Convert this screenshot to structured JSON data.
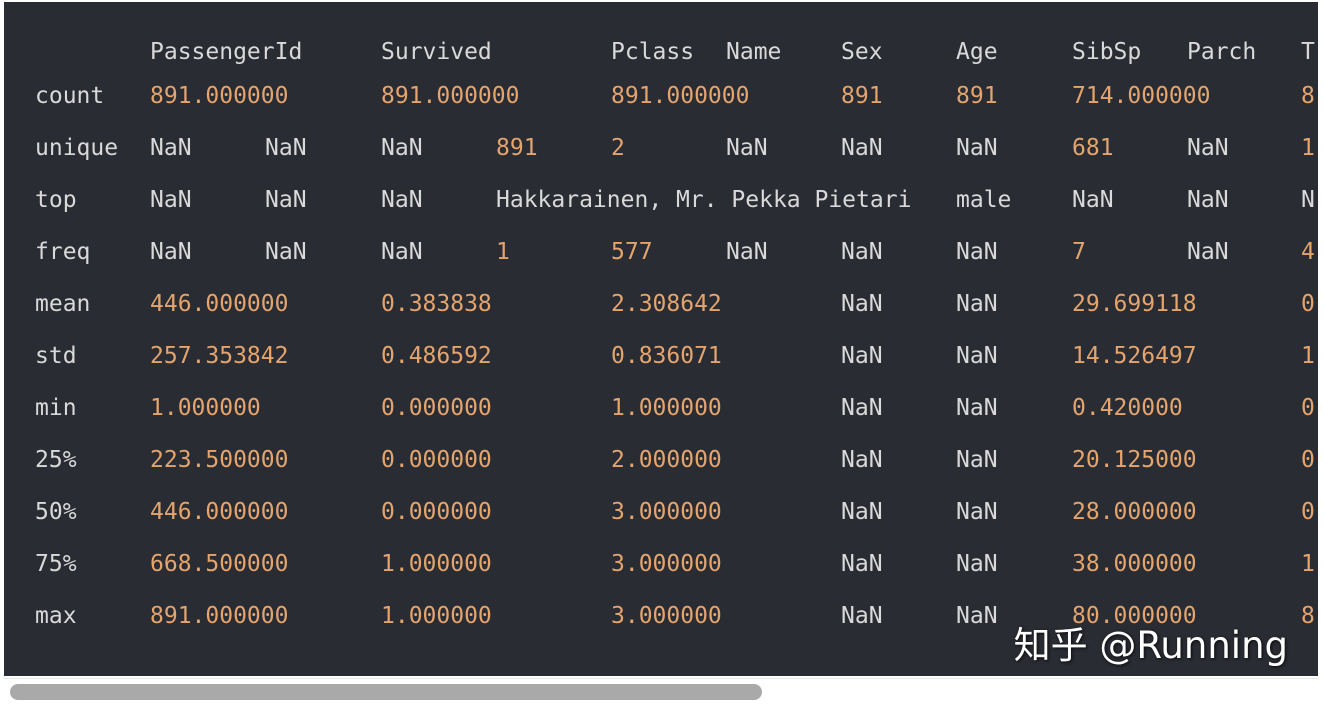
{
  "table": {
    "columns": [
      "PassengerId",
      "Survived",
      "Pclass",
      "Name",
      "Sex",
      "Age",
      "SibSp",
      "Parch",
      "T"
    ],
    "rows": [
      {
        "index": "count",
        "cells": [
          {
            "t": "891.000000",
            "k": "num"
          },
          {
            "t": "891.000000",
            "k": "num"
          },
          {
            "t": "891.000000",
            "k": "num"
          },
          {
            "t": "891",
            "k": "num"
          },
          {
            "t": "891",
            "k": "num"
          },
          {
            "t": "714.000000",
            "k": "num"
          },
          {
            "t": "8",
            "k": "num"
          }
        ]
      },
      {
        "index": "unique",
        "cells": [
          {
            "t": "NaN",
            "k": "nan"
          },
          {
            "t": "NaN",
            "k": "nan"
          },
          {
            "t": "NaN",
            "k": "nan"
          },
          {
            "t": "891",
            "k": "num"
          },
          {
            "t": "2",
            "k": "num"
          },
          {
            "t": "NaN",
            "k": "nan"
          },
          {
            "t": "NaN",
            "k": "nan"
          },
          {
            "t": "NaN",
            "k": "nan"
          },
          {
            "t": "681",
            "k": "num"
          },
          {
            "t": "NaN",
            "k": "nan"
          },
          {
            "t": "1",
            "k": "num"
          }
        ]
      },
      {
        "index": "top",
        "cells": [
          {
            "t": "NaN",
            "k": "nan"
          },
          {
            "t": "NaN",
            "k": "nan"
          },
          {
            "t": "NaN",
            "k": "nan"
          },
          {
            "t": "Hakkarainen, Mr. Pekka Pietari",
            "k": "str"
          },
          {
            "t": "male",
            "k": "str"
          },
          {
            "t": "NaN",
            "k": "nan"
          },
          {
            "t": "NaN",
            "k": "nan"
          },
          {
            "t": "N",
            "k": "nan"
          }
        ]
      },
      {
        "index": "freq",
        "cells": [
          {
            "t": "NaN",
            "k": "nan"
          },
          {
            "t": "NaN",
            "k": "nan"
          },
          {
            "t": "NaN",
            "k": "nan"
          },
          {
            "t": "1",
            "k": "num"
          },
          {
            "t": "577",
            "k": "num"
          },
          {
            "t": "NaN",
            "k": "nan"
          },
          {
            "t": "NaN",
            "k": "nan"
          },
          {
            "t": "NaN",
            "k": "nan"
          },
          {
            "t": "7",
            "k": "num"
          },
          {
            "t": "NaN",
            "k": "nan"
          },
          {
            "t": "4",
            "k": "num"
          }
        ]
      },
      {
        "index": "mean",
        "cells": [
          {
            "t": "446.000000",
            "k": "num"
          },
          {
            "t": "0.383838",
            "k": "num"
          },
          {
            "t": "2.308642",
            "k": "num"
          },
          {
            "t": "NaN",
            "k": "nan"
          },
          {
            "t": "NaN",
            "k": "nan"
          },
          {
            "t": "29.699118",
            "k": "num"
          },
          {
            "t": "0",
            "k": "num"
          }
        ]
      },
      {
        "index": "std",
        "cells": [
          {
            "t": "257.353842",
            "k": "num"
          },
          {
            "t": "0.486592",
            "k": "num"
          },
          {
            "t": "0.836071",
            "k": "num"
          },
          {
            "t": "NaN",
            "k": "nan"
          },
          {
            "t": "NaN",
            "k": "nan"
          },
          {
            "t": "14.526497",
            "k": "num"
          },
          {
            "t": "1",
            "k": "num"
          }
        ]
      },
      {
        "index": "min",
        "cells": [
          {
            "t": "1.000000",
            "k": "num"
          },
          {
            "t": "0.000000",
            "k": "num"
          },
          {
            "t": "1.000000",
            "k": "num"
          },
          {
            "t": "NaN",
            "k": "nan"
          },
          {
            "t": "NaN",
            "k": "nan"
          },
          {
            "t": "0.420000",
            "k": "num"
          },
          {
            "t": "0",
            "k": "num"
          }
        ]
      },
      {
        "index": "25%",
        "cells": [
          {
            "t": "223.500000",
            "k": "num"
          },
          {
            "t": "0.000000",
            "k": "num"
          },
          {
            "t": "2.000000",
            "k": "num"
          },
          {
            "t": "NaN",
            "k": "nan"
          },
          {
            "t": "NaN",
            "k": "nan"
          },
          {
            "t": "20.125000",
            "k": "num"
          },
          {
            "t": "0",
            "k": "num"
          }
        ]
      },
      {
        "index": "50%",
        "cells": [
          {
            "t": "446.000000",
            "k": "num"
          },
          {
            "t": "0.000000",
            "k": "num"
          },
          {
            "t": "3.000000",
            "k": "num"
          },
          {
            "t": "NaN",
            "k": "nan"
          },
          {
            "t": "NaN",
            "k": "nan"
          },
          {
            "t": "28.000000",
            "k": "num"
          },
          {
            "t": "0",
            "k": "num"
          }
        ]
      },
      {
        "index": "75%",
        "cells": [
          {
            "t": "668.500000",
            "k": "num"
          },
          {
            "t": "1.000000",
            "k": "num"
          },
          {
            "t": "3.000000",
            "k": "num"
          },
          {
            "t": "NaN",
            "k": "nan"
          },
          {
            "t": "NaN",
            "k": "nan"
          },
          {
            "t": "38.000000",
            "k": "num"
          },
          {
            "t": "1",
            "k": "num"
          }
        ]
      },
      {
        "index": "max",
        "cells": [
          {
            "t": "891.000000",
            "k": "num"
          },
          {
            "t": "1.000000",
            "k": "num"
          },
          {
            "t": "3.000000",
            "k": "num"
          },
          {
            "t": "NaN",
            "k": "nan"
          },
          {
            "t": "NaN",
            "k": "nan"
          },
          {
            "t": "80.000000",
            "k": "num"
          },
          {
            "t": "8",
            "k": "num"
          }
        ]
      }
    ]
  },
  "watermark": "知乎 @Running",
  "colors": {
    "panel_background": "#2a2c33",
    "text": "#d9d9d9",
    "number": "#e4a46d",
    "scrollbar_thumb": "#a9a9a9"
  }
}
